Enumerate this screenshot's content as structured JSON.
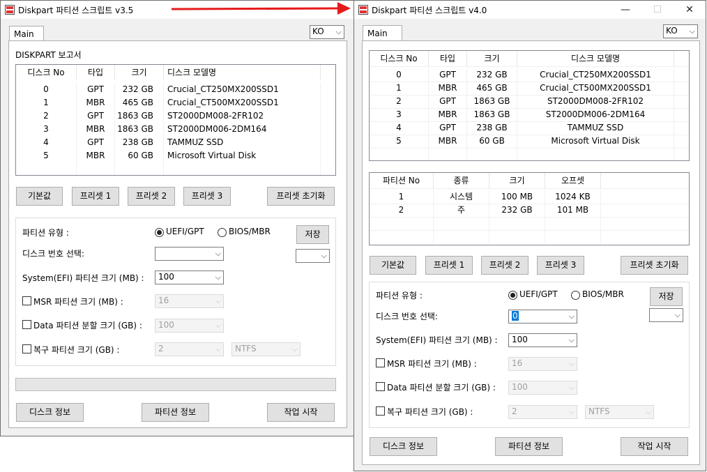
{
  "colors": {
    "arrow": "#e51b1b",
    "window_bg": "#f0f0f0",
    "selection": "#0078d7"
  },
  "left_window": {
    "title": "Diskpart 파티션 스크립트 v3.5",
    "tab": "Main",
    "lang": "KO",
    "report_label": "DISKPART 보고서",
    "disk_table": {
      "headers": [
        "디스크 No",
        "타입",
        "크기",
        "디스크 모델명"
      ],
      "rows": [
        [
          "0",
          "GPT",
          "232 GB",
          "Crucial_CT250MX200SSD1"
        ],
        [
          "1",
          "MBR",
          "465 GB",
          "Crucial_CT500MX200SSD1"
        ],
        [
          "2",
          "GPT",
          "1863 GB",
          "ST2000DM008-2FR102"
        ],
        [
          "3",
          "MBR",
          "1863 GB",
          "ST2000DM006-2DM164"
        ],
        [
          "4",
          "GPT",
          "238 GB",
          "TAMMUZ SSD"
        ],
        [
          "5",
          "MBR",
          "60 GB",
          "Microsoft Virtual Disk"
        ]
      ]
    },
    "buttons": {
      "default": "기본값",
      "preset1": "프리셋 1",
      "preset2": "프리셋 2",
      "preset3": "프리셋 3",
      "reset": "프리셋 초기화",
      "save": "저장",
      "disk_info": "디스크 정보",
      "partition_info": "파티션 정보",
      "start": "작업 시작"
    },
    "form": {
      "partition_type_label": "파티션 유형 :",
      "uefi_label": "UEFI/GPT",
      "bios_label": "BIOS/MBR",
      "disk_select_label": "디스크 번호 선택:",
      "disk_select_value": "",
      "save_select_value": "",
      "efi_label": "System(EFI) 파티션 크기 (MB) :",
      "efi_value": "100",
      "msr_label": "MSR 파티션 크기 (MB) :",
      "msr_value": "16",
      "data_label": "Data 파티션 분할 크기 (GB) :",
      "data_value": "100",
      "recovery_label": "복구 파티션 크기 (GB) :",
      "recovery_value": "2",
      "fs_value": "NTFS"
    },
    "progress": 0
  },
  "right_window": {
    "title": "Diskpart 파티션 스크립트 v4.0",
    "controls": {
      "minimize": "—",
      "maximize": "☐",
      "close": "✕"
    },
    "tab": "Main",
    "lang": "KO",
    "disk_table": {
      "headers": [
        "디스크 No",
        "타입",
        "크기",
        "디스크 모델명"
      ],
      "rows": [
        [
          "0",
          "GPT",
          "232 GB",
          "Crucial_CT250MX200SSD1"
        ],
        [
          "1",
          "MBR",
          "465 GB",
          "Crucial_CT500MX200SSD1"
        ],
        [
          "2",
          "GPT",
          "1863 GB",
          "ST2000DM008-2FR102"
        ],
        [
          "3",
          "MBR",
          "1863 GB",
          "ST2000DM006-2DM164"
        ],
        [
          "4",
          "GPT",
          "238 GB",
          "TAMMUZ SSD"
        ],
        [
          "5",
          "MBR",
          "60 GB",
          "Microsoft Virtual Disk"
        ]
      ]
    },
    "partition_table": {
      "headers": [
        "파티션 No",
        "종류",
        "크기",
        "오프셋"
      ],
      "rows": [
        [
          "1",
          "시스템",
          "100 MB",
          "1024 KB"
        ],
        [
          "2",
          "주",
          "232 GB",
          "101 MB"
        ]
      ]
    },
    "buttons": {
      "default": "기본값",
      "preset1": "프리셋 1",
      "preset2": "프리셋 2",
      "preset3": "프리셋 3",
      "reset": "프리셋 초기화",
      "save": "저장",
      "disk_info": "디스크 정보",
      "partition_info": "파티션 정보",
      "start": "작업 시작"
    },
    "form": {
      "partition_type_label": "파티션 유형 :",
      "uefi_label": "UEFI/GPT",
      "bios_label": "BIOS/MBR",
      "disk_select_label": "디스크 번호 선택:",
      "disk_select_value": "0",
      "save_select_value": "",
      "efi_label": "System(EFI) 파티션 크기 (MB) :",
      "efi_value": "100",
      "msr_label": "MSR 파티션 크기 (MB) :",
      "msr_value": "16",
      "data_label": "Data 파티션 분할 크기 (GB) :",
      "data_value": "100",
      "recovery_label": "복구 파티션 크기 (GB) :",
      "recovery_value": "2",
      "fs_value": "NTFS"
    }
  }
}
